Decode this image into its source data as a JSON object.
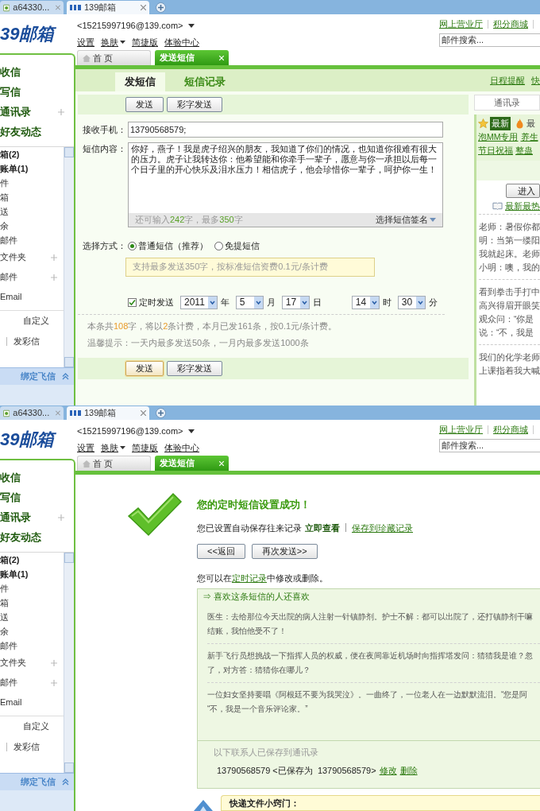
{
  "screens": [
    {
      "browser_tabs": [
        {
          "label": "a64330...",
          "selected": false
        },
        {
          "label": "139邮箱",
          "selected": true
        }
      ],
      "logo": "39邮箱",
      "account": "<15215997196@139.com>",
      "header_links": [
        "设置",
        "换肤",
        "简捷版",
        "体验中心"
      ],
      "top_links": [
        "网上营业厅",
        "积分商城"
      ],
      "search": {
        "placeholder": "邮件搜索..."
      },
      "app_tabs": [
        {
          "label": "首 页",
          "selected": false
        },
        {
          "label": "发送短信",
          "selected": true
        }
      ],
      "sidebar": {
        "main": [
          {
            "label": "收信",
            "addable": false
          },
          {
            "label": "写信",
            "addable": false
          },
          {
            "label": "通讯录",
            "addable": true
          },
          {
            "label": "好友动态",
            "addable": false
          }
        ],
        "folders": [
          {
            "label": "箱(2)",
            "kind": "folder",
            "unread": true,
            "addable": false
          },
          {
            "label": "账单(1)",
            "kind": "folder",
            "unread": true,
            "addable": false
          },
          {
            "label": "件",
            "kind": "folder",
            "unread": false,
            "addable": false
          },
          {
            "label": "箱",
            "kind": "folder",
            "unread": false,
            "addable": false
          },
          {
            "label": "送",
            "kind": "folder",
            "unread": false,
            "addable": false
          },
          {
            "label": "余",
            "kind": "folder",
            "unread": false,
            "addable": false
          },
          {
            "label": "邮件",
            "kind": "folder",
            "unread": false,
            "addable": false
          },
          {
            "label": "文件夹",
            "kind": "group",
            "unread": false,
            "addable": true
          },
          {
            "label": "邮件",
            "kind": "group",
            "unread": false,
            "addable": true
          },
          {
            "label": "Email",
            "kind": "group",
            "unread": false,
            "addable": false
          }
        ],
        "custom": "自定义",
        "mms": "发彩信",
        "fetion": "绑定飞信"
      },
      "content": {
        "kind": "compose",
        "subtabs": [
          {
            "label": "发短信",
            "selected": true
          },
          {
            "label": "短信记录",
            "selected": false
          }
        ],
        "right_links": [
          "日程提醒",
          "快"
        ],
        "toolbar_buttons": [
          "发送",
          "彩字发送"
        ],
        "recipient": {
          "label": "接收手机：",
          "value": "13790568579;"
        },
        "message": {
          "label": "短信内容：",
          "value": "你好，燕子！我是虎子绍兴的朋友，我知道了你们的情况，也知道你很难有很大的压力。虎子让我转达你：他希望能和你牵手一辈子，愿意与你一承担以后每一个日子里的开心快乐及泪水压力！相信虎子，他会珍惜你一辈子，呵护你一生！",
          "counter": [
            {
              "text": "还可输入",
              "highlight": false
            },
            {
              "text": "242",
              "highlight": true
            },
            {
              "text": "字，最多",
              "highlight": false
            },
            {
              "text": "350",
              "highlight": true
            },
            {
              "text": "字",
              "highlight": false
            }
          ],
          "signature": "选择短信签名"
        },
        "mode": {
          "label": "选择方式：",
          "options": [
            {
              "label": "普通短信（推荐）",
              "selected": true
            },
            {
              "label": "免提短信",
              "selected": false
            }
          ],
          "tip": "支持最多发送350字，按标准短信资费0.1元/条计费"
        },
        "schedule": {
          "label": "定时发送",
          "checked": true,
          "date": [
            {
              "value": "2011",
              "unit": "年"
            },
            {
              "value": "5",
              "unit": "月"
            },
            {
              "value": "17",
              "unit": "日"
            }
          ],
          "time": [
            {
              "value": "14",
              "unit": "时"
            },
            {
              "value": "30",
              "unit": "分"
            }
          ]
        },
        "summary": [
          {
            "text": "本条共",
            "highlight": false
          },
          {
            "text": "108",
            "highlight": true
          },
          {
            "text": "字，将以",
            "highlight": false
          },
          {
            "text": "2",
            "highlight": true
          },
          {
            "text": "条计费，本月已发161条，按0.1元/条计费。",
            "highlight": false
          }
        ],
        "notice": "温馨提示：一天内最多发送50条，一月内最多发送1000条",
        "bottom_buttons": [
          {
            "label": "发送",
            "focused": true
          },
          {
            "label": "彩字发送",
            "focused": false
          }
        ],
        "side_panel": {
          "tab": "通讯录",
          "filters": [
            {
              "label": "最新",
              "selected": true
            },
            {
              "label": "最",
              "selected": false
            }
          ],
          "link_rows": [
            [
              "泡MM专用",
              "养生"
            ],
            [
              "节日祝福",
              "整蛊"
            ]
          ],
          "enter_button": "进入",
          "hot_link": "最新最热",
          "jokes": [
            [
              "老师：暑假你都",
              "明：当第一缕阳",
              "我就起床。老师",
              "小明：噢，我的"
            ],
            [
              "看到拳击手打中",
              "高兴得眉开眼笑",
              "观众问：“你是",
              "说：“不，我是"
            ],
            [
              "我们的化学老师",
              "上课指着我大喊"
            ]
          ]
        }
      }
    },
    {
      "browser_tabs": [
        {
          "label": "a64330...",
          "selected": false
        },
        {
          "label": "139邮箱",
          "selected": true
        }
      ],
      "logo": "39邮箱",
      "account": "<15215997196@139.com>",
      "header_links": [
        "设置",
        "换肤",
        "简捷版",
        "体验中心"
      ],
      "top_links": [
        "网上营业厅",
        "积分商城"
      ],
      "search": {
        "placeholder": "邮件搜索..."
      },
      "app_tabs": [
        {
          "label": "首 页",
          "selected": false
        },
        {
          "label": "发送短信",
          "selected": true
        }
      ],
      "sidebar": {
        "main": [
          {
            "label": "收信",
            "addable": false
          },
          {
            "label": "写信",
            "addable": false
          },
          {
            "label": "通讯录",
            "addable": true
          },
          {
            "label": "好友动态",
            "addable": false
          }
        ],
        "folders": [
          {
            "label": "箱(2)",
            "kind": "folder",
            "unread": true,
            "addable": false
          },
          {
            "label": "账单(1)",
            "kind": "folder",
            "unread": true,
            "addable": false
          },
          {
            "label": "件",
            "kind": "folder",
            "unread": false,
            "addable": false
          },
          {
            "label": "箱",
            "kind": "folder",
            "unread": false,
            "addable": false
          },
          {
            "label": "送",
            "kind": "folder",
            "unread": false,
            "addable": false
          },
          {
            "label": "余",
            "kind": "folder",
            "unread": false,
            "addable": false
          },
          {
            "label": "邮件",
            "kind": "folder",
            "unread": false,
            "addable": false
          },
          {
            "label": "文件夹",
            "kind": "group",
            "unread": false,
            "addable": true
          },
          {
            "label": "邮件",
            "kind": "group",
            "unread": false,
            "addable": true
          },
          {
            "label": "Email",
            "kind": "group",
            "unread": false,
            "addable": false
          }
        ],
        "custom": "自定义",
        "mms": "发彩信",
        "fetion": "绑定飞信"
      },
      "content": {
        "kind": "result",
        "title": "您的定时短信设置成功！",
        "saved_note": "您已设置自动保存往来记录",
        "view_link": "立即查看",
        "save_link": "保存到珍藏记录",
        "buttons": [
          "<<返回",
          "再次发送>>"
        ],
        "edit_note": {
          "before": "您可以在",
          "link": "定时记录",
          "after": "中修改或删除。"
        },
        "recommend": {
          "title": "⇒ 喜欢这条短信的人还喜欢",
          "jokes": [
            [
              "医生：去给那位今天出院的病人注射一针镇静剂。护士不解：都可以出院了，还打镇静剂干嘛",
              "结账，我怕他受不了！"
            ],
            [
              "新手飞行员想挑战一下指挥人员的权威，便在夜间靠近机场时向指挥塔发问：猜猜我是谁？忽",
              "了，对方答：猜猜你在哪儿？"
            ],
            [
              "一位妇女坚持要唱《阿根廷不要为我哭泣》。一曲终了，一位老人在一边默默流泪。“您是阿",
              "“不，我是一个音乐评论家。”"
            ]
          ]
        },
        "contacts": {
          "title": "以下联系人已保存到通讯录",
          "entries": [
            {
              "text": "13790568579 <已保存为  13790568579>",
              "edit": "修改",
              "delete": "删除"
            }
          ]
        },
        "tip_title": "快递文件小窍门："
      }
    }
  ]
}
